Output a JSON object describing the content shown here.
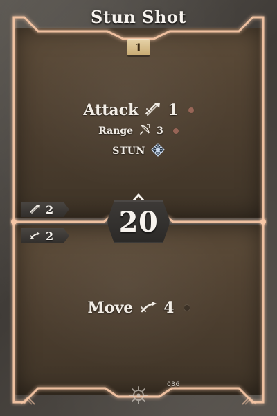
{
  "card": {
    "title": "Stun Shot",
    "level": "1",
    "initiative": "20",
    "card_number": "036"
  },
  "top_action": {
    "attack": {
      "label": "Attack",
      "value": "1",
      "icon": "attack-icon"
    },
    "range": {
      "label": "Range",
      "value": "3",
      "icon": "range-icon"
    },
    "condition": {
      "label": "STUN",
      "icon": "stun-icon"
    }
  },
  "bottom_action": {
    "move": {
      "label": "Move",
      "value": "4",
      "icon": "move-icon"
    }
  },
  "side_stats": {
    "attack": {
      "value": "2",
      "icon": "attack-icon"
    },
    "move": {
      "value": "2",
      "icon": "move-icon"
    }
  },
  "colors": {
    "frame_glow": "#f7c7a6",
    "level_badge": "#d9bf86",
    "parchment": "#56473a",
    "stone": "#4a4540"
  }
}
